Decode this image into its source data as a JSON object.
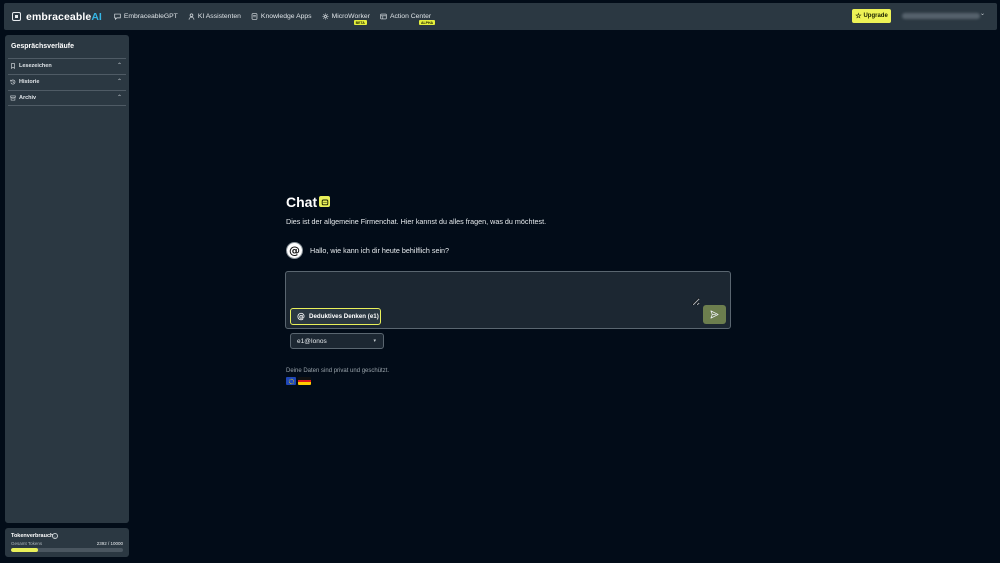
{
  "header": {
    "logo_text": "embraceable",
    "logo_accent": "AI",
    "nav": [
      {
        "label": "EmbraceableGPT",
        "icon": "chat-icon",
        "badge": ""
      },
      {
        "label": "KI Assistenten",
        "icon": "user-icon",
        "badge": ""
      },
      {
        "label": "Knowledge Apps",
        "icon": "document-icon",
        "badge": ""
      },
      {
        "label": "MicroWorker",
        "icon": "gear-icon",
        "badge": "BETA"
      },
      {
        "label": "Action Center",
        "icon": "grid-icon",
        "badge": "ALPHA"
      }
    ],
    "upgrade_label": "Upgrade"
  },
  "sidebar": {
    "title": "Gesprächsverläufe",
    "sections": [
      {
        "label": "Lesezeichen",
        "icon": "bookmark-icon"
      },
      {
        "label": "Historie",
        "icon": "history-icon"
      },
      {
        "label": "Archiv",
        "icon": "archive-icon"
      }
    ]
  },
  "tokens": {
    "title": "Tokenverbrauch",
    "subtitle": "Gesamt Tokens",
    "count": "2392 / 10000",
    "used": 2392,
    "total": 10000
  },
  "main": {
    "title": "Chat",
    "description": "Dies ist der allgemeine Firmenchat. Hier kannst du alles fragen, was du möchtest.",
    "assistant_message": "Hallo, wie kann ich dir heute behilflich sein?",
    "input_value": "",
    "input_placeholder": "",
    "mode_label": "Deduktives Denken (e1)",
    "model_selected": "e1@Ionos",
    "privacy_text": "Deine Daten sind privat und geschützt."
  },
  "colors": {
    "accent": "#e9f05a",
    "background": "#020c18",
    "panel": "#2b3842",
    "logo_accent": "#35b6e6"
  }
}
